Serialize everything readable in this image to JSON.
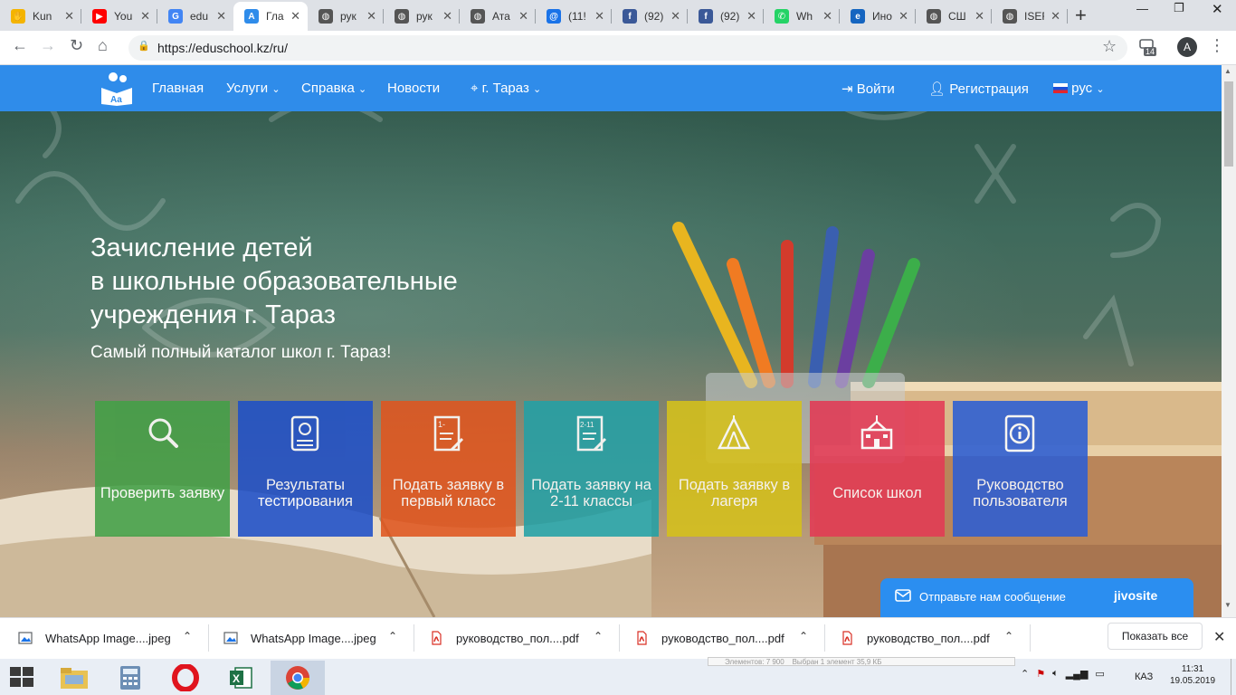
{
  "browser": {
    "tabs": [
      {
        "title": "Kun",
        "icon": "hand-logo-icon",
        "color": "#f4b400"
      },
      {
        "title": "You",
        "icon": "youtube-icon",
        "color": "#ff0000"
      },
      {
        "title": "edu",
        "icon": "google-icon",
        "color": "#4285f4"
      },
      {
        "title": "Гла",
        "icon": "eduschool-icon",
        "color": "#2f8cea"
      },
      {
        "title": "рук",
        "icon": "globe-icon",
        "color": "#555555"
      },
      {
        "title": "рук",
        "icon": "globe-icon",
        "color": "#555555"
      },
      {
        "title": "Ата",
        "icon": "globe-icon",
        "color": "#555555"
      },
      {
        "title": "(11!",
        "icon": "mail-icon",
        "color": "#1a73e8"
      },
      {
        "title": "(92)",
        "icon": "facebook-icon",
        "color": "#3b5998"
      },
      {
        "title": "(92)",
        "icon": "facebook-icon",
        "color": "#3b5998"
      },
      {
        "title": "Wh",
        "icon": "whatsapp-icon",
        "color": "#25d366"
      },
      {
        "title": "Ино",
        "icon": "ie-icon",
        "color": "#1565c0"
      },
      {
        "title": "СШ",
        "icon": "globe-icon",
        "color": "#555555"
      },
      {
        "title": "ISEF",
        "icon": "globe-icon",
        "color": "#555555"
      }
    ],
    "active_tab_index": 3,
    "url": "https://eduschool.kz/ru/",
    "extension_badge": "14",
    "profile_initial": "A"
  },
  "site": {
    "nav": {
      "home": "Главная",
      "services": "Услуги",
      "help": "Справка",
      "news": "Новости",
      "city": "г. Тараз",
      "login": "Войти",
      "register": "Регистрация",
      "language": "рус"
    },
    "hero": {
      "title_lines": [
        "Зачисление детей",
        "в школьные образовательные",
        "учреждения г. Тараз"
      ],
      "subtitle": "Самый полный каталог школ г. Тараз!"
    },
    "tiles": [
      {
        "label": "Проверить заявку",
        "icon": "magnifier-icon",
        "color": "#43a047"
      },
      {
        "label": "Результаты тестирования",
        "icon": "test-results-icon",
        "color": "#1e50c8"
      },
      {
        "label": "Подать заявку в первый класс",
        "icon": "grade-1-application-icon",
        "color": "#e0561f"
      },
      {
        "label": "Подать заявку на 2-11 классы",
        "icon": "grade-2-11-application-icon",
        "color": "#23a1a6"
      },
      {
        "label": "Подать заявку в лагеря",
        "icon": "tent-icon",
        "color": "#d5c11b"
      },
      {
        "label": "Список школ",
        "icon": "school-building-icon",
        "color": "#e33a55"
      },
      {
        "label": "Руководство пользователя",
        "icon": "info-booklet-icon",
        "color": "#2c5ed4"
      }
    ],
    "chat_widget": {
      "message": "Отправьте нам сообщение",
      "brand": "jivosite"
    }
  },
  "downloads": {
    "items": [
      {
        "name": "WhatsApp Image....jpeg",
        "type": "image-file-icon"
      },
      {
        "name": "WhatsApp Image....jpeg",
        "type": "image-file-icon"
      },
      {
        "name": "руководство_пол....pdf",
        "type": "pdf-file-icon"
      },
      {
        "name": "руководство_пол....pdf",
        "type": "pdf-file-icon"
      },
      {
        "name": "руководство_пол....pdf",
        "type": "pdf-file-icon"
      }
    ],
    "show_all": "Показать все"
  },
  "taskbar": {
    "apps": [
      "file-explorer-icon",
      "calculator-icon",
      "opera-icon",
      "excel-icon",
      "chrome-icon"
    ],
    "language": "КАЗ",
    "time": "11:31",
    "date": "19.05.2019"
  }
}
